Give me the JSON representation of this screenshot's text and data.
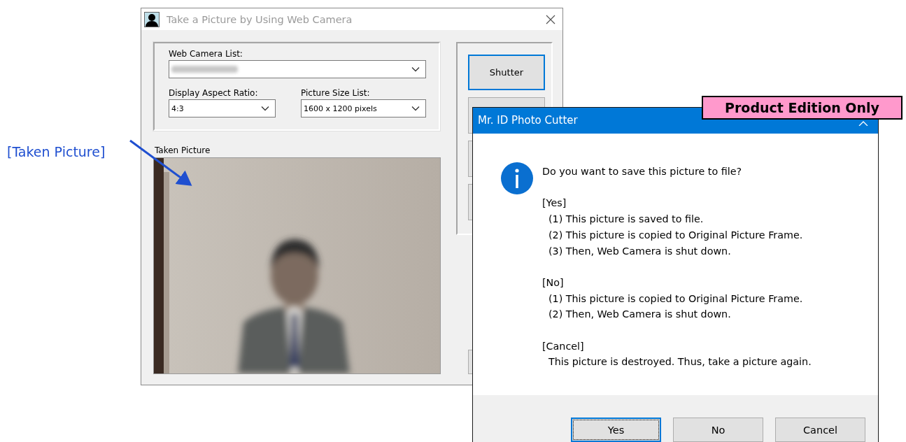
{
  "callout": {
    "text": "[Taken Picture]"
  },
  "main_window": {
    "title": "Take a Picture by Using Web Camera",
    "camera_group": {
      "camera_list": {
        "label": "Web Camera List:",
        "redacted": true
      },
      "aspect_ratio": {
        "label": "Display Aspect Ratio:",
        "value": "4:3"
      },
      "picture_size": {
        "label": "Picture Size List:",
        "value": "1600 x 1200 pixels"
      }
    },
    "picture_label": "Taken Picture",
    "shutter_button": {
      "label": "Shutter",
      "focused": true
    }
  },
  "dialog": {
    "title": "Mr. ID Photo Cutter",
    "kind": "info",
    "question": "Do you want to save this picture to file?",
    "sections": [
      {
        "heading": "[Yes]",
        "lines": [
          "(1) This picture is saved to file.",
          "(2) This picture is copied to Original Picture Frame.",
          "(3) Then, Web Camera is shut down."
        ]
      },
      {
        "heading": "[No]",
        "lines": [
          "(1) This picture is copied to Original Picture Frame.",
          "(2) Then, Web Camera is shut down."
        ]
      },
      {
        "heading": "[Cancel]",
        "lines": [
          "This picture is destroyed. Thus, take a picture again."
        ]
      }
    ],
    "buttons": [
      {
        "label": "Yes",
        "focused": true
      },
      {
        "label": "No",
        "focused": false
      },
      {
        "label": "Cancel",
        "focused": false
      }
    ]
  },
  "badge": {
    "text": "Product Edition Only"
  }
}
